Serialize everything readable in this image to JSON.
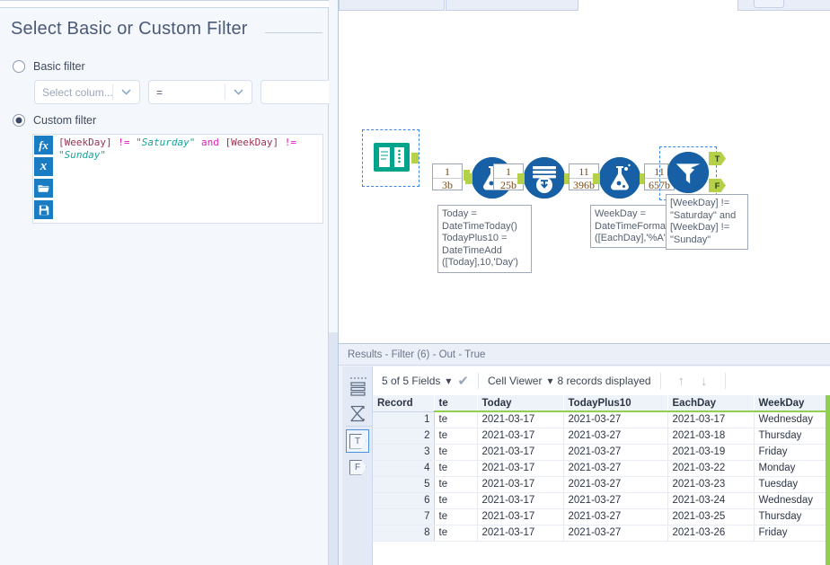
{
  "config_panel": {
    "title": "Select Basic or Custom Filter",
    "basic": {
      "label": "Basic filter",
      "column_placeholder": "Select colum...",
      "operator_value": "=",
      "value_text": ""
    },
    "custom": {
      "label": "Custom filter",
      "selected": true,
      "expression_tokens": [
        {
          "text": "[WeekDay]",
          "kind": "field"
        },
        {
          "text": " ",
          "kind": "plain"
        },
        {
          "text": "!=",
          "kind": "op"
        },
        {
          "text": " ",
          "kind": "plain"
        },
        {
          "text": "\"Saturday\"",
          "kind": "str"
        },
        {
          "text": " ",
          "kind": "plain"
        },
        {
          "text": "and",
          "kind": "kw"
        },
        {
          "text": " ",
          "kind": "plain"
        },
        {
          "text": "[WeekDay]",
          "kind": "field"
        },
        {
          "text": " ",
          "kind": "plain"
        },
        {
          "text": "!=",
          "kind": "op"
        },
        {
          "text": "\n",
          "kind": "plain"
        },
        {
          "text": "\"Sunday\"",
          "kind": "str"
        }
      ],
      "expression_plain": "[WeekDay] != \"Saturday\" and [WeekDay] != \"Sunday\"",
      "toolbar_buttons": [
        {
          "name": "function-fx-icon",
          "glyph": "fx"
        },
        {
          "name": "variable-x-icon",
          "glyph": "x"
        },
        {
          "name": "open-folder-icon",
          "glyph": "▰"
        },
        {
          "name": "save-disk-icon",
          "glyph": "▣"
        }
      ]
    }
  },
  "canvas": {
    "tools": [
      {
        "name": "text-input-tool",
        "type": "text-input",
        "selected": true
      },
      {
        "name": "formula-tool-1",
        "type": "formula",
        "selected": false
      },
      {
        "name": "generate-rows-tool",
        "type": "generate-rows",
        "selected": false
      },
      {
        "name": "formula-tool-2",
        "type": "formula",
        "selected": false
      },
      {
        "name": "filter-tool",
        "type": "filter",
        "selected": true
      }
    ],
    "record_counts": [
      {
        "records": "1",
        "size": "3b"
      },
      {
        "records": "1",
        "size": "25b"
      },
      {
        "records": "11",
        "size": "396b"
      },
      {
        "records": "11",
        "size": "657b"
      }
    ],
    "annotations": [
      {
        "name": "formula-1-annotation",
        "lines": [
          "Today =",
          "DateTimeToday()",
          "TodayPlus10 =",
          "DateTimeAdd",
          "([Today],10,'Day')"
        ]
      },
      {
        "name": "formula-2-annotation",
        "lines": [
          "WeekDay =",
          "DateTimeForma",
          "([EachDay],'%A'"
        ]
      },
      {
        "name": "filter-annotation",
        "lines": [
          "[WeekDay] !=",
          "\"Saturday\" and",
          "[WeekDay] !=",
          "\"Sunday\""
        ]
      }
    ],
    "filter_anchors": {
      "true_label": "T",
      "false_label": "F"
    }
  },
  "results": {
    "header": "Results - Filter (6) - Out - True",
    "toolbar": {
      "fields": "5 of 5 Fields",
      "viewer": "Cell Viewer",
      "records": "8 records displayed",
      "up_arrow": "↑",
      "down_arrow": "↓",
      "check": "✔",
      "caret": "▾"
    },
    "rail": {
      "data_icon": "data-list-icon",
      "sum_icon": "∑",
      "true_anchor": "T",
      "false_anchor": "F"
    },
    "columns": [
      "Record",
      "te",
      "Today",
      "TodayPlus10",
      "EachDay",
      "WeekDay"
    ],
    "rows": [
      {
        "Record": "1",
        "te": "te",
        "Today": "2021-03-17",
        "TodayPlus10": "2021-03-27",
        "EachDay": "2021-03-17",
        "WeekDay": "Wednesday"
      },
      {
        "Record": "2",
        "te": "te",
        "Today": "2021-03-17",
        "TodayPlus10": "2021-03-27",
        "EachDay": "2021-03-18",
        "WeekDay": "Thursday"
      },
      {
        "Record": "3",
        "te": "te",
        "Today": "2021-03-17",
        "TodayPlus10": "2021-03-27",
        "EachDay": "2021-03-19",
        "WeekDay": "Friday"
      },
      {
        "Record": "4",
        "te": "te",
        "Today": "2021-03-17",
        "TodayPlus10": "2021-03-27",
        "EachDay": "2021-03-22",
        "WeekDay": "Monday"
      },
      {
        "Record": "5",
        "te": "te",
        "Today": "2021-03-17",
        "TodayPlus10": "2021-03-27",
        "EachDay": "2021-03-23",
        "WeekDay": "Tuesday"
      },
      {
        "Record": "6",
        "te": "te",
        "Today": "2021-03-17",
        "TodayPlus10": "2021-03-27",
        "EachDay": "2021-03-24",
        "WeekDay": "Wednesday"
      },
      {
        "Record": "7",
        "te": "te",
        "Today": "2021-03-17",
        "TodayPlus10": "2021-03-27",
        "EachDay": "2021-03-25",
        "WeekDay": "Thursday"
      },
      {
        "Record": "8",
        "te": "te",
        "Today": "2021-03-17",
        "TodayPlus10": "2021-03-27",
        "EachDay": "2021-03-26",
        "WeekDay": "Friday"
      }
    ]
  },
  "colors": {
    "accent_blue": "#1760a5",
    "anchor_green": "#b5d14a",
    "header_underline": "#8fd14f",
    "text_input_teal": "#00a38c",
    "panel_bg": "#f4f7fb"
  }
}
